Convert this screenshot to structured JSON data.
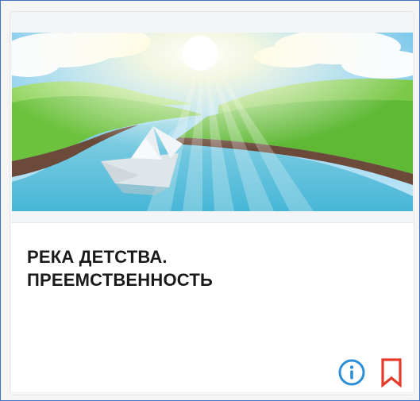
{
  "card": {
    "title": "РЕКА ДЕТСТВА.\nПРЕЕМСТВЕННОСТЬ",
    "image_icon": "landscape-river-paper-boat",
    "actions": {
      "info_icon": "info-icon",
      "bookmark_icon": "bookmark-icon"
    }
  },
  "colors": {
    "frame_border": "#4472c4",
    "info_blue": "#2b8fd6",
    "bookmark_red": "#e63a2a",
    "title": "#1a1a1a"
  }
}
